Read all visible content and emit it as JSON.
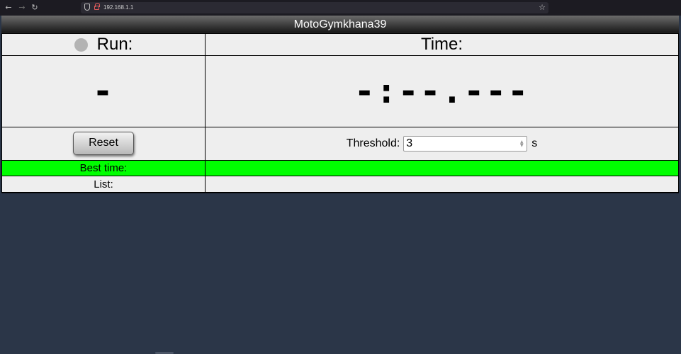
{
  "browser": {
    "url": "192.168.1.1",
    "back_icon": "arrow-left-icon",
    "forward_icon": "arrow-right-icon",
    "reload_icon": "reload-icon",
    "bookmark_icon": "star-icon"
  },
  "app": {
    "title": "MotoGymkhana39",
    "run_label": "Run:",
    "time_label": "Time:",
    "run_value": "-",
    "time_value": "-:--.---",
    "reset_label": "Reset",
    "threshold_label": "Threshold:",
    "threshold_value": "3",
    "threshold_unit": "s",
    "best_time_label": "Best time:",
    "best_time_value": "",
    "list_label": "List:",
    "list_value": ""
  },
  "colors": {
    "page_background": "#2b3648",
    "best_time_row": "#00ff00",
    "status_indicator": "#b3b3b3",
    "cell_background": "#eeeeee"
  }
}
